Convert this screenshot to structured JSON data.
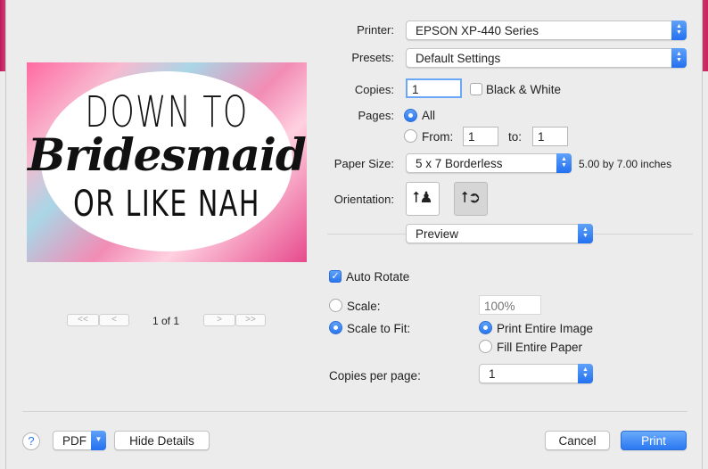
{
  "printer": {
    "label": "Printer:",
    "value": "EPSON XP-440 Series"
  },
  "presets": {
    "label": "Presets:",
    "value": "Default Settings"
  },
  "copies": {
    "label": "Copies:",
    "value": "1",
    "bw_label": "Black & White"
  },
  "pages": {
    "label": "Pages:",
    "all_label": "All",
    "from_label": "From:",
    "from_value": "1",
    "to_label": "to:",
    "to_value": "1"
  },
  "paper_size": {
    "label": "Paper Size:",
    "value": "5 x 7 Borderless",
    "dimensions": "5.00 by 7.00 inches"
  },
  "orientation": {
    "label": "Orientation:",
    "selected": "landscape"
  },
  "section": {
    "value": "Preview"
  },
  "auto_rotate": {
    "label": "Auto Rotate",
    "checked": true
  },
  "scale": {
    "label": "Scale:",
    "placeholder": "100%"
  },
  "scale_to_fit": {
    "label": "Scale to Fit:",
    "selected": true
  },
  "fit_options": {
    "print_entire_image": "Print Entire Image",
    "fill_entire_paper": "Fill Entire Paper"
  },
  "copies_per_page": {
    "label": "Copies per page:",
    "value": "1"
  },
  "preview_image": {
    "line1": "DOWN TO",
    "line2": "Bridesmaid",
    "line3": "OR LIKE NAH"
  },
  "page_nav": {
    "page_label": "1 of 1",
    "first": "<<",
    "prev": "<",
    "next": ">",
    "last": ">>"
  },
  "footer": {
    "help": "?",
    "pdf": "PDF",
    "hide_details": "Hide Details",
    "cancel": "Cancel",
    "print": "Print"
  },
  "colors": {
    "accent": "#2b78f2"
  }
}
